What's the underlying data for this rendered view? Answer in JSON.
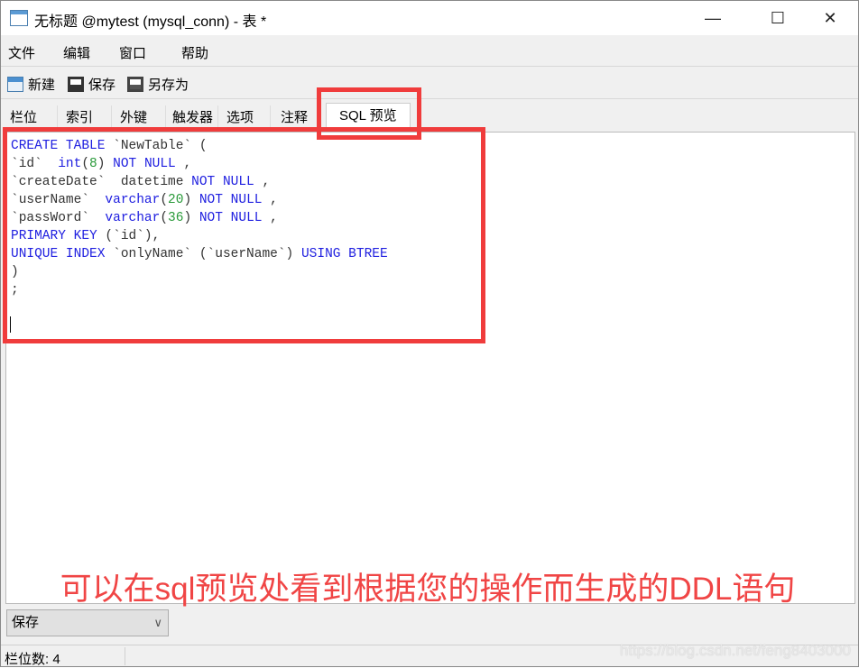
{
  "window": {
    "title": "无标题 @mytest (mysql_conn) - 表 *",
    "minimize": "—",
    "maximize": "☐",
    "close": "✕"
  },
  "menu": [
    "文件",
    "编辑",
    "窗口",
    "帮助"
  ],
  "toolbar": {
    "new_label": "新建",
    "save_label": "保存",
    "save_as_label": "另存为"
  },
  "tabs": [
    {
      "label": "栏位"
    },
    {
      "label": "索引"
    },
    {
      "label": "外键"
    },
    {
      "label": "触发器"
    },
    {
      "label": "选项"
    },
    {
      "label": "注释"
    },
    {
      "label": "SQL 预览",
      "active": true
    }
  ],
  "sql_lines": [
    [
      [
        "kw",
        "CREATE TABLE"
      ],
      [
        "tx",
        " `NewTable` ("
      ]
    ],
    [
      [
        "tx",
        "`id`  "
      ],
      [
        "kw",
        "int"
      ],
      [
        "tx",
        "("
      ],
      [
        "num",
        "8"
      ],
      [
        "tx",
        ") "
      ],
      [
        "kw",
        "NOT NULL"
      ],
      [
        "tx",
        " ,"
      ]
    ],
    [
      [
        "tx",
        "`createDate`  datetime "
      ],
      [
        "kw",
        "NOT NULL"
      ],
      [
        "tx",
        " ,"
      ]
    ],
    [
      [
        "tx",
        "`userName`  "
      ],
      [
        "kw",
        "varchar"
      ],
      [
        "tx",
        "("
      ],
      [
        "num",
        "20"
      ],
      [
        "tx",
        ") "
      ],
      [
        "kw",
        "NOT NULL"
      ],
      [
        "tx",
        " ,"
      ]
    ],
    [
      [
        "tx",
        "`passWord`  "
      ],
      [
        "kw",
        "varchar"
      ],
      [
        "tx",
        "("
      ],
      [
        "num",
        "36"
      ],
      [
        "tx",
        ") "
      ],
      [
        "kw",
        "NOT NULL"
      ],
      [
        "tx",
        " ,"
      ]
    ],
    [
      [
        "kw",
        "PRIMARY KEY"
      ],
      [
        "tx",
        " (`id`),"
      ]
    ],
    [
      [
        "kw",
        "UNIQUE INDEX"
      ],
      [
        "tx",
        " `onlyName` (`userName`) "
      ],
      [
        "kw",
        "USING BTREE"
      ]
    ],
    [
      [
        "tx",
        ")"
      ]
    ],
    [
      [
        "tx",
        ";"
      ]
    ]
  ],
  "annotation": "可以在sql预览处看到根据您的操作而生成的DDL语句",
  "save_select": {
    "value": "保存"
  },
  "status": {
    "field_count": "栏位数: 4"
  },
  "watermark": "https://blog.csdn.net/feng8403000",
  "colors": {
    "keyword": "#2020e0",
    "number": "#2a9a3a",
    "highlight": "#f03c3c"
  }
}
